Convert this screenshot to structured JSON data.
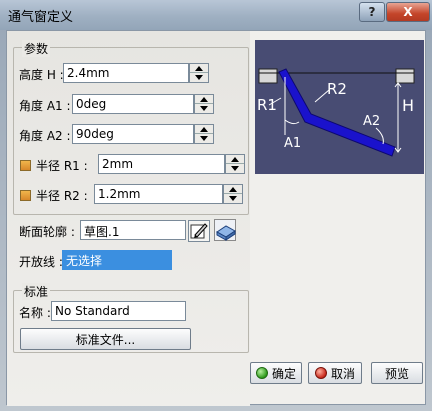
{
  "window": {
    "title": "通气窗定义",
    "help_label": "?",
    "close_label": "X"
  },
  "params": {
    "group_label": "参数",
    "height": {
      "label": "高度 H :",
      "value": "2.4mm"
    },
    "angle_a1": {
      "label": "角度 A1 :",
      "value": "0deg"
    },
    "angle_a2": {
      "label": "角度 A2 :",
      "value": "90deg"
    },
    "radius_r1": {
      "label": "半径 R1 :",
      "value": "2mm"
    },
    "radius_r2": {
      "label": "半径 R2 :",
      "value": "1.2mm"
    }
  },
  "profile": {
    "label": "断面轮廓 :",
    "value": "草图.1"
  },
  "open_line": {
    "label": "开放线 :",
    "value": "无选择"
  },
  "standard": {
    "group_label": "标准",
    "name_label": "名称 :",
    "name_value": "No Standard",
    "file_button": "标准文件..."
  },
  "diagram": {
    "labels": [
      "R1",
      "R2",
      "A1",
      "A2",
      "H"
    ]
  },
  "buttons": {
    "ok": "确定",
    "cancel": "取消",
    "preview": "预览"
  },
  "colors": {
    "preview_bg": "#484c73",
    "profile_blue": "#1a12cc",
    "selection_blue": "#3b8fe0"
  }
}
